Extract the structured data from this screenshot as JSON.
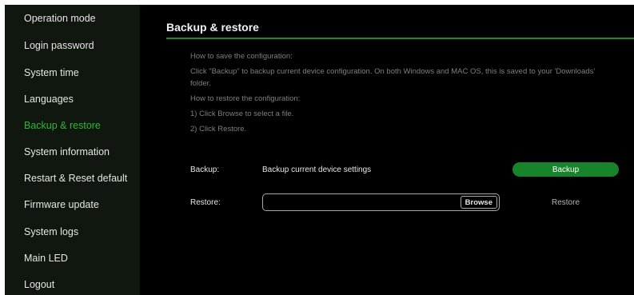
{
  "sidebar": {
    "items": [
      {
        "label": "Operation mode"
      },
      {
        "label": "Login password"
      },
      {
        "label": "System time"
      },
      {
        "label": "Languages"
      },
      {
        "label": "Backup & restore",
        "active": true
      },
      {
        "label": "System information"
      },
      {
        "label": "Restart & Reset default"
      },
      {
        "label": "Firmware update"
      },
      {
        "label": "System logs"
      },
      {
        "label": "Main LED"
      },
      {
        "label": "Logout"
      }
    ]
  },
  "main": {
    "title": "Backup & restore",
    "info_lines": [
      "How to save the configuration:",
      "Click \"Backup\" to backup current device configuration. On both Windows and MAC OS, this is saved to your 'Downloads'",
      "folder.",
      "How to restore the configuration:",
      "1) Click Browse to select a file.",
      "2) Click Restore."
    ],
    "backup": {
      "label": "Backup:",
      "description": "Backup current device settings",
      "button_label": "Backup"
    },
    "restore": {
      "label": "Restore:",
      "file_value": "",
      "browse_label": "Browse",
      "button_label": "Restore"
    }
  },
  "colors": {
    "accent": "#2eb82e",
    "button_green": "#17832a",
    "sidebar_bg": "#10170f",
    "main_bg": "#000000"
  }
}
